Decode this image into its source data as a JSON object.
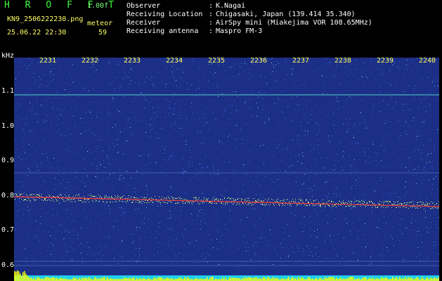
{
  "header": {
    "program": "H R O F F T",
    "version": "1.00f",
    "filename": "KN9_2506222230.png",
    "mode": "meteor",
    "datetime": "25.06.22 22:30",
    "count": "59"
  },
  "info": [
    {
      "key": "Observer",
      "value": "K.Nagai"
    },
    {
      "key": "Receiving Location",
      "value": "Chigasaki, Japan (139.414 35.340)"
    },
    {
      "key": "Receiver",
      "value": "AirSpy mini (Miakejima VOR 108.65MHz)"
    },
    {
      "key": "Receiving antenna",
      "value": "Maspro FM-3"
    }
  ],
  "y_axis": {
    "unit": "kHz",
    "ticks": [
      "1.1",
      "1.0",
      "0.9",
      "0.8",
      "0.7",
      "0.6"
    ]
  },
  "x_axis": {
    "ticks": [
      "2231",
      "2232",
      "2233",
      "2234",
      "2235",
      "2236",
      "2237",
      "2238",
      "2239",
      "2240"
    ]
  },
  "colors": {
    "background": "#1c2f86",
    "carrier": "#ff3a3a",
    "level_bar": "#ffff00",
    "text_yellow": "#ffff66",
    "text_green": "#3cff3c"
  }
}
